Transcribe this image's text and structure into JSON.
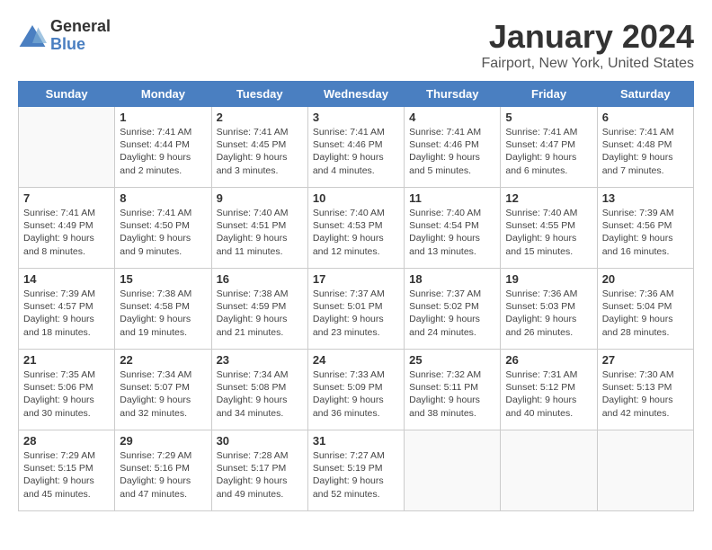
{
  "header": {
    "logo_general": "General",
    "logo_blue": "Blue",
    "title": "January 2024",
    "subtitle": "Fairport, New York, United States"
  },
  "days_of_week": [
    "Sunday",
    "Monday",
    "Tuesday",
    "Wednesday",
    "Thursday",
    "Friday",
    "Saturday"
  ],
  "weeks": [
    [
      {
        "day": "",
        "info": ""
      },
      {
        "day": "1",
        "info": "Sunrise: 7:41 AM\nSunset: 4:44 PM\nDaylight: 9 hours\nand 2 minutes."
      },
      {
        "day": "2",
        "info": "Sunrise: 7:41 AM\nSunset: 4:45 PM\nDaylight: 9 hours\nand 3 minutes."
      },
      {
        "day": "3",
        "info": "Sunrise: 7:41 AM\nSunset: 4:46 PM\nDaylight: 9 hours\nand 4 minutes."
      },
      {
        "day": "4",
        "info": "Sunrise: 7:41 AM\nSunset: 4:46 PM\nDaylight: 9 hours\nand 5 minutes."
      },
      {
        "day": "5",
        "info": "Sunrise: 7:41 AM\nSunset: 4:47 PM\nDaylight: 9 hours\nand 6 minutes."
      },
      {
        "day": "6",
        "info": "Sunrise: 7:41 AM\nSunset: 4:48 PM\nDaylight: 9 hours\nand 7 minutes."
      }
    ],
    [
      {
        "day": "7",
        "info": "Sunrise: 7:41 AM\nSunset: 4:49 PM\nDaylight: 9 hours\nand 8 minutes."
      },
      {
        "day": "8",
        "info": "Sunrise: 7:41 AM\nSunset: 4:50 PM\nDaylight: 9 hours\nand 9 minutes."
      },
      {
        "day": "9",
        "info": "Sunrise: 7:40 AM\nSunset: 4:51 PM\nDaylight: 9 hours\nand 11 minutes."
      },
      {
        "day": "10",
        "info": "Sunrise: 7:40 AM\nSunset: 4:53 PM\nDaylight: 9 hours\nand 12 minutes."
      },
      {
        "day": "11",
        "info": "Sunrise: 7:40 AM\nSunset: 4:54 PM\nDaylight: 9 hours\nand 13 minutes."
      },
      {
        "day": "12",
        "info": "Sunrise: 7:40 AM\nSunset: 4:55 PM\nDaylight: 9 hours\nand 15 minutes."
      },
      {
        "day": "13",
        "info": "Sunrise: 7:39 AM\nSunset: 4:56 PM\nDaylight: 9 hours\nand 16 minutes."
      }
    ],
    [
      {
        "day": "14",
        "info": "Sunrise: 7:39 AM\nSunset: 4:57 PM\nDaylight: 9 hours\nand 18 minutes."
      },
      {
        "day": "15",
        "info": "Sunrise: 7:38 AM\nSunset: 4:58 PM\nDaylight: 9 hours\nand 19 minutes."
      },
      {
        "day": "16",
        "info": "Sunrise: 7:38 AM\nSunset: 4:59 PM\nDaylight: 9 hours\nand 21 minutes."
      },
      {
        "day": "17",
        "info": "Sunrise: 7:37 AM\nSunset: 5:01 PM\nDaylight: 9 hours\nand 23 minutes."
      },
      {
        "day": "18",
        "info": "Sunrise: 7:37 AM\nSunset: 5:02 PM\nDaylight: 9 hours\nand 24 minutes."
      },
      {
        "day": "19",
        "info": "Sunrise: 7:36 AM\nSunset: 5:03 PM\nDaylight: 9 hours\nand 26 minutes."
      },
      {
        "day": "20",
        "info": "Sunrise: 7:36 AM\nSunset: 5:04 PM\nDaylight: 9 hours\nand 28 minutes."
      }
    ],
    [
      {
        "day": "21",
        "info": "Sunrise: 7:35 AM\nSunset: 5:06 PM\nDaylight: 9 hours\nand 30 minutes."
      },
      {
        "day": "22",
        "info": "Sunrise: 7:34 AM\nSunset: 5:07 PM\nDaylight: 9 hours\nand 32 minutes."
      },
      {
        "day": "23",
        "info": "Sunrise: 7:34 AM\nSunset: 5:08 PM\nDaylight: 9 hours\nand 34 minutes."
      },
      {
        "day": "24",
        "info": "Sunrise: 7:33 AM\nSunset: 5:09 PM\nDaylight: 9 hours\nand 36 minutes."
      },
      {
        "day": "25",
        "info": "Sunrise: 7:32 AM\nSunset: 5:11 PM\nDaylight: 9 hours\nand 38 minutes."
      },
      {
        "day": "26",
        "info": "Sunrise: 7:31 AM\nSunset: 5:12 PM\nDaylight: 9 hours\nand 40 minutes."
      },
      {
        "day": "27",
        "info": "Sunrise: 7:30 AM\nSunset: 5:13 PM\nDaylight: 9 hours\nand 42 minutes."
      }
    ],
    [
      {
        "day": "28",
        "info": "Sunrise: 7:29 AM\nSunset: 5:15 PM\nDaylight: 9 hours\nand 45 minutes."
      },
      {
        "day": "29",
        "info": "Sunrise: 7:29 AM\nSunset: 5:16 PM\nDaylight: 9 hours\nand 47 minutes."
      },
      {
        "day": "30",
        "info": "Sunrise: 7:28 AM\nSunset: 5:17 PM\nDaylight: 9 hours\nand 49 minutes."
      },
      {
        "day": "31",
        "info": "Sunrise: 7:27 AM\nSunset: 5:19 PM\nDaylight: 9 hours\nand 52 minutes."
      },
      {
        "day": "",
        "info": ""
      },
      {
        "day": "",
        "info": ""
      },
      {
        "day": "",
        "info": ""
      }
    ]
  ]
}
